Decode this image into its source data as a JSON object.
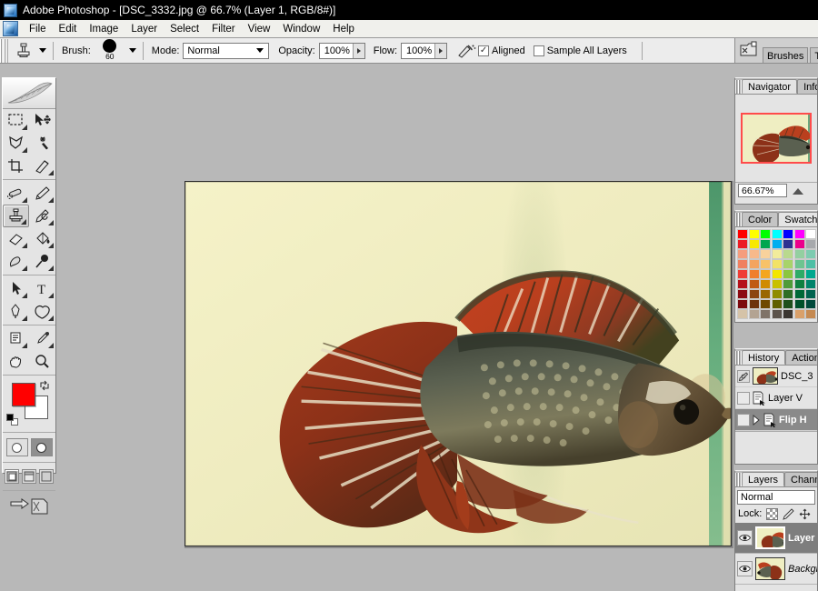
{
  "window": {
    "title": "Adobe Photoshop - [DSC_3332.jpg @ 66.7% (Layer 1, RGB/8#)]",
    "app_icon": "photoshop-icon"
  },
  "menu": {
    "items": [
      "File",
      "Edit",
      "Image",
      "Layer",
      "Select",
      "Filter",
      "View",
      "Window",
      "Help"
    ]
  },
  "options_bar": {
    "tool_icon": "clone-stamp-icon",
    "brush_label": "Brush:",
    "brush_size": "60",
    "mode_label": "Mode:",
    "mode_value": "Normal",
    "opacity_label": "Opacity:",
    "opacity_value": "100%",
    "flow_label": "Flow:",
    "flow_value": "100%",
    "airbrush_icon": "airbrush-icon",
    "aligned_label": "Aligned",
    "aligned_checked": true,
    "sample_all_layers_label": "Sample All Layers",
    "sample_all_layers_checked": false,
    "brush_presets_icon": "brush-presets-icon",
    "palette_well_icon": "palette-well-icon",
    "well_tabs": [
      "Brushes",
      "T"
    ]
  },
  "toolbox": {
    "logo_icon": "feather-logo",
    "tools": [
      {
        "name": "rectangular-marquee-tool",
        "icon": "marquee-icon",
        "active": false,
        "has_flyout": true
      },
      {
        "name": "move-tool",
        "icon": "move-icon",
        "active": false,
        "has_flyout": false
      },
      {
        "name": "lasso-tool",
        "icon": "lasso-icon",
        "active": false,
        "has_flyout": true
      },
      {
        "name": "magic-wand-tool",
        "icon": "magic-wand-icon",
        "active": false,
        "has_flyout": false
      },
      {
        "name": "crop-tool",
        "icon": "crop-icon",
        "active": false,
        "has_flyout": false
      },
      {
        "name": "slice-tool",
        "icon": "slice-icon",
        "active": false,
        "has_flyout": true
      },
      {
        "name": "healing-brush-tool",
        "icon": "healing-brush-icon",
        "active": false,
        "has_flyout": true
      },
      {
        "name": "brush-tool",
        "icon": "paintbrush-icon",
        "active": false,
        "has_flyout": true
      },
      {
        "name": "clone-stamp-tool",
        "icon": "clone-stamp-icon",
        "active": true,
        "has_flyout": true
      },
      {
        "name": "history-brush-tool",
        "icon": "history-brush-icon",
        "active": false,
        "has_flyout": true
      },
      {
        "name": "eraser-tool",
        "icon": "eraser-icon",
        "active": false,
        "has_flyout": true
      },
      {
        "name": "gradient-tool",
        "icon": "paint-bucket-icon",
        "active": false,
        "has_flyout": true
      },
      {
        "name": "blur-tool",
        "icon": "smudge-icon",
        "active": false,
        "has_flyout": true
      },
      {
        "name": "dodge-tool",
        "icon": "dodge-icon",
        "active": false,
        "has_flyout": true
      },
      {
        "name": "path-selection-tool",
        "icon": "path-select-icon",
        "active": false,
        "has_flyout": true
      },
      {
        "name": "type-tool",
        "icon": "type-icon",
        "active": false,
        "has_flyout": true
      },
      {
        "name": "pen-tool",
        "icon": "pen-icon",
        "active": false,
        "has_flyout": true
      },
      {
        "name": "custom-shape-tool",
        "icon": "custom-shape-icon",
        "active": false,
        "has_flyout": true
      },
      {
        "name": "notes-tool",
        "icon": "notes-icon",
        "active": false,
        "has_flyout": true
      },
      {
        "name": "eyedropper-tool",
        "icon": "eyedropper-icon",
        "active": false,
        "has_flyout": true
      },
      {
        "name": "hand-tool",
        "icon": "hand-icon",
        "active": false,
        "has_flyout": false
      },
      {
        "name": "zoom-tool",
        "icon": "zoom-icon",
        "active": false,
        "has_flyout": false
      }
    ],
    "foreground_color": "#ff0000",
    "background_color": "#ffffff",
    "swap_icon": "swap-colors-icon",
    "default_colors_icon": "default-colors-icon",
    "quick_mask": {
      "standard_selected": false,
      "quickmask_selected": true
    },
    "screen_modes": {
      "selected_index": 0
    },
    "jump_to_imageready_icon": "jump-to-imageready-icon"
  },
  "document": {
    "filename": "DSC_3332.jpg",
    "zoom": "66.7%",
    "layer": "Layer 1",
    "mode": "RGB/8#",
    "image_subject": "betta-fish-photo",
    "background_color": "#f2efc3",
    "glass_strip_color": "#4f9a6b"
  },
  "navigator": {
    "tabs": [
      {
        "label": "Navigator",
        "selected": true
      },
      {
        "label": "Info",
        "selected": false
      }
    ],
    "zoom_value": "66.67%",
    "view_box_color": "#ff4b4b",
    "zoom_slider_icon": "zoom-slider-icon"
  },
  "swatches": {
    "tabs": [
      {
        "label": "Color",
        "selected": false
      },
      {
        "label": "Swatches",
        "selected": true
      }
    ],
    "colors": [
      [
        "#ff0000",
        "#ffff00",
        "#00ff00",
        "#00ffff",
        "#0000ff",
        "#ff00ff",
        "#ffffff"
      ],
      [
        "#ec1c24",
        "#f7e800",
        "#00a650",
        "#00aeef",
        "#2e3192",
        "#ec008c",
        "#a7a9ac"
      ],
      [
        "#f59d7e",
        "#f7b98a",
        "#f9d29c",
        "#f2ec9b",
        "#b9d98e",
        "#93cfa0",
        "#7dcbb0"
      ],
      [
        "#f08060",
        "#f4a460",
        "#f7c268",
        "#f2e267",
        "#a8d36a",
        "#6ec490",
        "#4ebfa5"
      ],
      [
        "#ef3e36",
        "#f07f2d",
        "#f4a61e",
        "#f3e600",
        "#8cc63f",
        "#2eab66",
        "#00a88e"
      ],
      [
        "#b5121b",
        "#c05a12",
        "#d08b00",
        "#c8c000",
        "#4f9b38",
        "#0f8040",
        "#00846b"
      ],
      [
        "#8c0b12",
        "#8c4410",
        "#9a6700",
        "#8f8c00",
        "#2f6e26",
        "#006837",
        "#00634f"
      ],
      [
        "#7c0a0f",
        "#6e330c",
        "#6f4a00",
        "#5f6000",
        "#1f4f1c",
        "#00502a",
        "#004a3c"
      ],
      [
        "#d5c3a8",
        "#b3a392",
        "#7f7368",
        "#5c534b",
        "#3b3631",
        "#d9a06a",
        "#c58a52"
      ]
    ]
  },
  "history": {
    "tabs": [
      {
        "label": "History",
        "selected": true
      },
      {
        "label": "Actions",
        "selected": false
      }
    ],
    "items": [
      {
        "label": "DSC_3",
        "type": "snapshot",
        "selected": false,
        "has_thumbnail": true
      },
      {
        "label": "Layer V",
        "type": "state",
        "selected": false,
        "has_thumbnail": false
      },
      {
        "label": "Flip H",
        "type": "state",
        "selected": true,
        "has_thumbnail": false
      }
    ]
  },
  "layers": {
    "tabs": [
      {
        "label": "Layers",
        "selected": true
      },
      {
        "label": "Channels",
        "selected": false
      }
    ],
    "blend_mode": "Normal",
    "lock_label": "Lock:",
    "lock_icons": [
      "lock-transparency-icon",
      "lock-image-icon",
      "lock-position-icon"
    ],
    "rows": [
      {
        "name": "Layer",
        "visible": true,
        "selected": true,
        "italic": false
      },
      {
        "name": "Backgr",
        "visible": true,
        "selected": false,
        "italic": true
      }
    ]
  }
}
